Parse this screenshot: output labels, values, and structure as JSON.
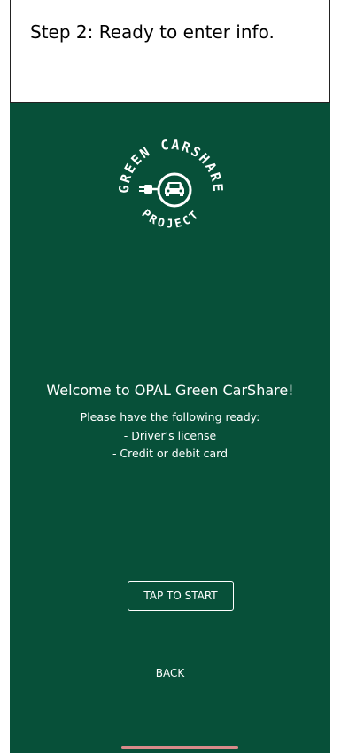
{
  "caption": {
    "text": "Step 2: Ready to enter info."
  },
  "logo": {
    "top_text": "GREEN CARSHARE",
    "bottom_text": "PROJECT"
  },
  "welcome": {
    "title": "Welcome to OPAL Green CarShare!",
    "line1": "Please have the following ready:",
    "line2": "- Driver's license",
    "line3": "- Credit or debit card"
  },
  "actions": {
    "start_label": "TAP TO START",
    "back_label": "BACK"
  },
  "colors": {
    "screen_bg": "#075039",
    "text": "#ffffff"
  },
  "icons": {
    "logo": "car-plug-icon"
  }
}
